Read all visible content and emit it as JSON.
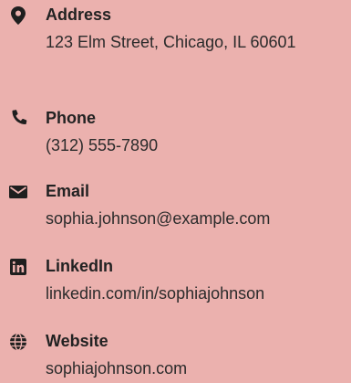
{
  "contacts": [
    {
      "label": "Address",
      "value": "123 Elm Street, Chicago, IL 60601",
      "icon": "map-marker-icon"
    },
    {
      "label": "Phone",
      "value": "(312) 555-7890",
      "icon": "phone-icon"
    },
    {
      "label": "Email",
      "value": "sophia.johnson@example.com",
      "icon": "envelope-icon"
    },
    {
      "label": "LinkedIn",
      "value": "linkedin.com/in/sophiajohnson",
      "icon": "linkedin-icon"
    },
    {
      "label": "Website",
      "value": "sophiajohnson.com",
      "icon": "globe-icon"
    }
  ],
  "colors": {
    "background": "#ebb1ae",
    "text": "#222222",
    "icon": "#1f1f1f"
  }
}
